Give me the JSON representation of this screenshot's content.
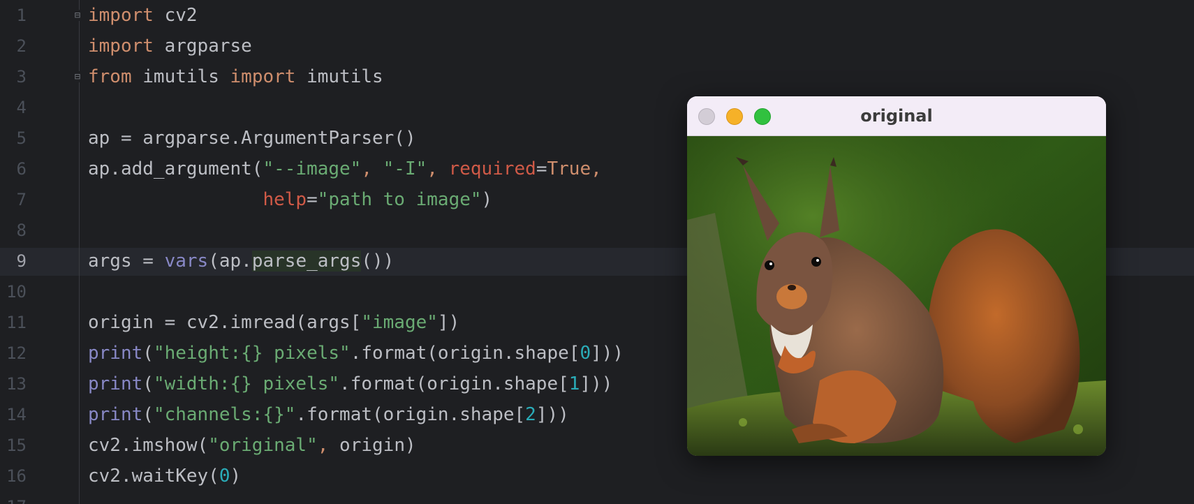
{
  "editor": {
    "active_line": 9,
    "lines": [
      {
        "num": "1",
        "tokens": [
          {
            "t": "import",
            "c": "kw"
          },
          {
            "t": " cv2",
            "c": ""
          }
        ]
      },
      {
        "num": "2",
        "tokens": [
          {
            "t": "import",
            "c": "kw"
          },
          {
            "t": " argparse",
            "c": ""
          }
        ]
      },
      {
        "num": "3",
        "tokens": [
          {
            "t": "from",
            "c": "kw"
          },
          {
            "t": " imutils ",
            "c": ""
          },
          {
            "t": "import",
            "c": "kw"
          },
          {
            "t": " imutils",
            "c": ""
          }
        ]
      },
      {
        "num": "4",
        "tokens": []
      },
      {
        "num": "5",
        "tokens": [
          {
            "t": "ap = argparse.ArgumentParser()",
            "c": ""
          }
        ]
      },
      {
        "num": "6",
        "tokens": [
          {
            "t": "ap.add_argument(",
            "c": ""
          },
          {
            "t": "\"--image\"",
            "c": "str"
          },
          {
            "t": ", ",
            "c": "kw"
          },
          {
            "t": "\"-I\"",
            "c": "str"
          },
          {
            "t": ", ",
            "c": "kw"
          },
          {
            "t": "required",
            "c": "param"
          },
          {
            "t": "=",
            "c": ""
          },
          {
            "t": "True",
            "c": "kw"
          },
          {
            "t": ",",
            "c": "kw"
          }
        ]
      },
      {
        "num": "7",
        "tokens": [
          {
            "t": "                ",
            "c": ""
          },
          {
            "t": "help",
            "c": "param"
          },
          {
            "t": "=",
            "c": ""
          },
          {
            "t": "\"path to image\"",
            "c": "str"
          },
          {
            "t": ")",
            "c": ""
          }
        ]
      },
      {
        "num": "8",
        "tokens": []
      },
      {
        "num": "9",
        "tokens": [
          {
            "t": "args = ",
            "c": ""
          },
          {
            "t": "vars",
            "c": "bi"
          },
          {
            "t": "(ap.",
            "c": ""
          },
          {
            "t": "parse_args",
            "c": "hl"
          },
          {
            "t": "())",
            "c": ""
          }
        ]
      },
      {
        "num": "10",
        "tokens": []
      },
      {
        "num": "11",
        "tokens": [
          {
            "t": "origin = cv2.imread(args[",
            "c": ""
          },
          {
            "t": "\"image\"",
            "c": "str"
          },
          {
            "t": "])",
            "c": ""
          }
        ]
      },
      {
        "num": "12",
        "tokens": [
          {
            "t": "print",
            "c": "bi"
          },
          {
            "t": "(",
            "c": ""
          },
          {
            "t": "\"height:{} pixels\"",
            "c": "str"
          },
          {
            "t": ".format(origin.shape[",
            "c": ""
          },
          {
            "t": "0",
            "c": "num"
          },
          {
            "t": "]))",
            "c": ""
          }
        ]
      },
      {
        "num": "13",
        "tokens": [
          {
            "t": "print",
            "c": "bi"
          },
          {
            "t": "(",
            "c": ""
          },
          {
            "t": "\"width:{} pixels\"",
            "c": "str"
          },
          {
            "t": ".format(origin.shape[",
            "c": ""
          },
          {
            "t": "1",
            "c": "num"
          },
          {
            "t": "]))",
            "c": ""
          }
        ]
      },
      {
        "num": "14",
        "tokens": [
          {
            "t": "print",
            "c": "bi"
          },
          {
            "t": "(",
            "c": ""
          },
          {
            "t": "\"channels:{}\"",
            "c": "str"
          },
          {
            "t": ".format(origin.shape[",
            "c": ""
          },
          {
            "t": "2",
            "c": "num"
          },
          {
            "t": "]))",
            "c": ""
          }
        ]
      },
      {
        "num": "15",
        "tokens": [
          {
            "t": "cv2.imshow(",
            "c": ""
          },
          {
            "t": "\"original\"",
            "c": "str"
          },
          {
            "t": ", ",
            "c": "kw"
          },
          {
            "t": "origin)",
            "c": ""
          }
        ]
      },
      {
        "num": "16",
        "tokens": [
          {
            "t": "cv2.waitKey(",
            "c": ""
          },
          {
            "t": "0",
            "c": "num"
          },
          {
            "t": ")",
            "c": ""
          }
        ]
      },
      {
        "num": "17",
        "tokens": []
      }
    ]
  },
  "cv_window": {
    "title": "original",
    "image_subject": "red squirrel sitting on mossy ground"
  },
  "colors": {
    "background": "#1e1f22",
    "keyword": "#cf8e6d",
    "string": "#6aab73",
    "number": "#2aacb8",
    "builtin": "#8888c6",
    "parameter": "#d05a47",
    "text": "#bcbec4"
  },
  "icons": [
    "fold-icon",
    "close-traffic-light-icon",
    "minimize-traffic-light-icon",
    "maximize-traffic-light-icon"
  ]
}
